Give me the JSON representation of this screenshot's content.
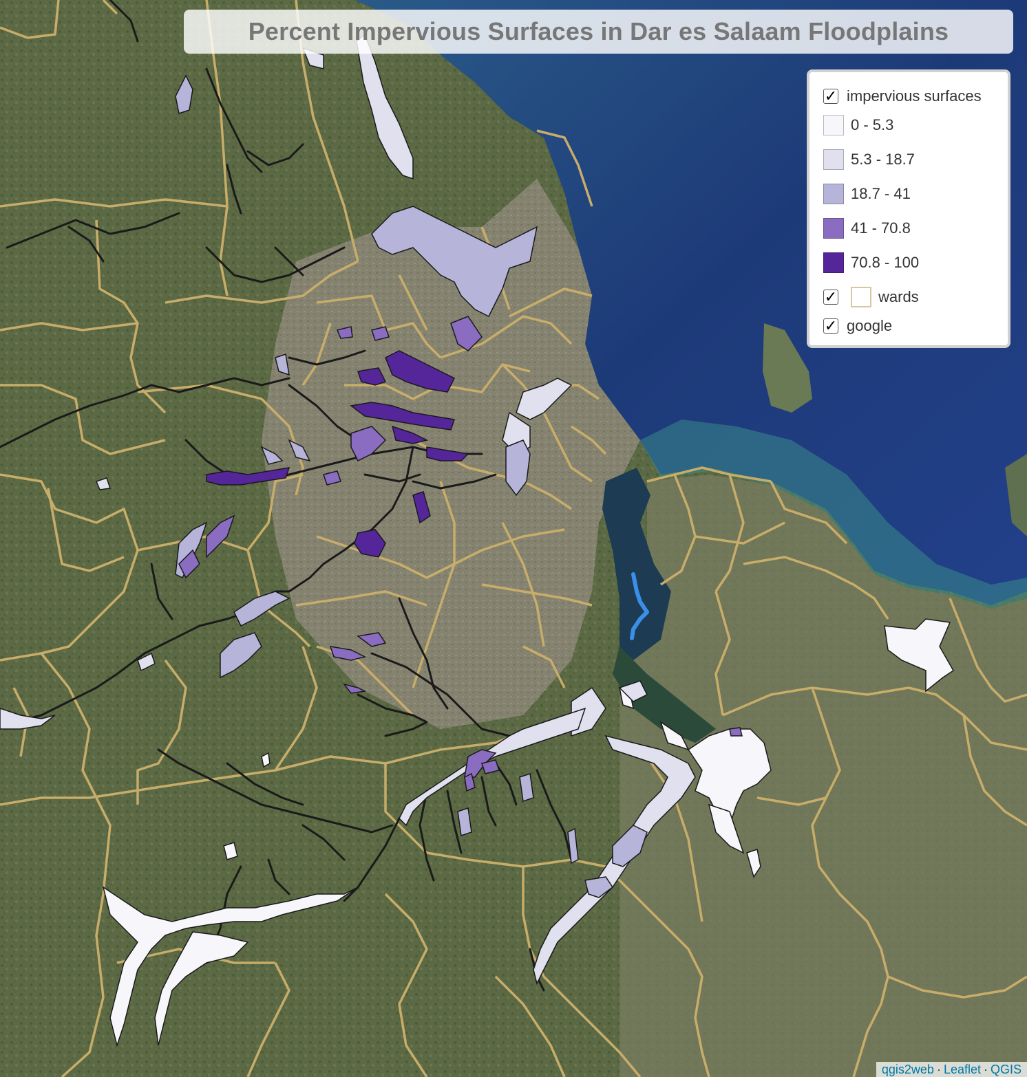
{
  "title": "Percent Impervious Surfaces in Dar es Salaam Floodplains",
  "colors": {
    "class_0": "#f2f0f7",
    "class_1": "#dadaeb",
    "class_2": "#bcbddc",
    "class_3": "#9e9ac8",
    "class_4": "#54278f",
    "ward_line": "#c8b070",
    "ocean": "#1e3f7a",
    "land": "#5d6a45",
    "urban": "#8a8777",
    "channel": "#3b8fe8"
  },
  "legend": {
    "layer_impervious": "impervious surfaces",
    "classes": [
      {
        "label": "0 - 5.3",
        "color": "#f7f7fb"
      },
      {
        "label": "5.3 - 18.7",
        "color": "#e1e0ef"
      },
      {
        "label": "18.7 - 41",
        "color": "#b6b4d9"
      },
      {
        "label": "41 - 70.8",
        "color": "#8a6cc0"
      },
      {
        "label": "70.8 - 100",
        "color": "#55269a"
      }
    ],
    "layer_wards": "wards",
    "layer_google": "google",
    "checked_mark": "✓"
  },
  "attribution": {
    "qgis2web": "qgis2web",
    "leaflet": "Leaflet",
    "qgis": "QGIS",
    "separator": "·"
  }
}
